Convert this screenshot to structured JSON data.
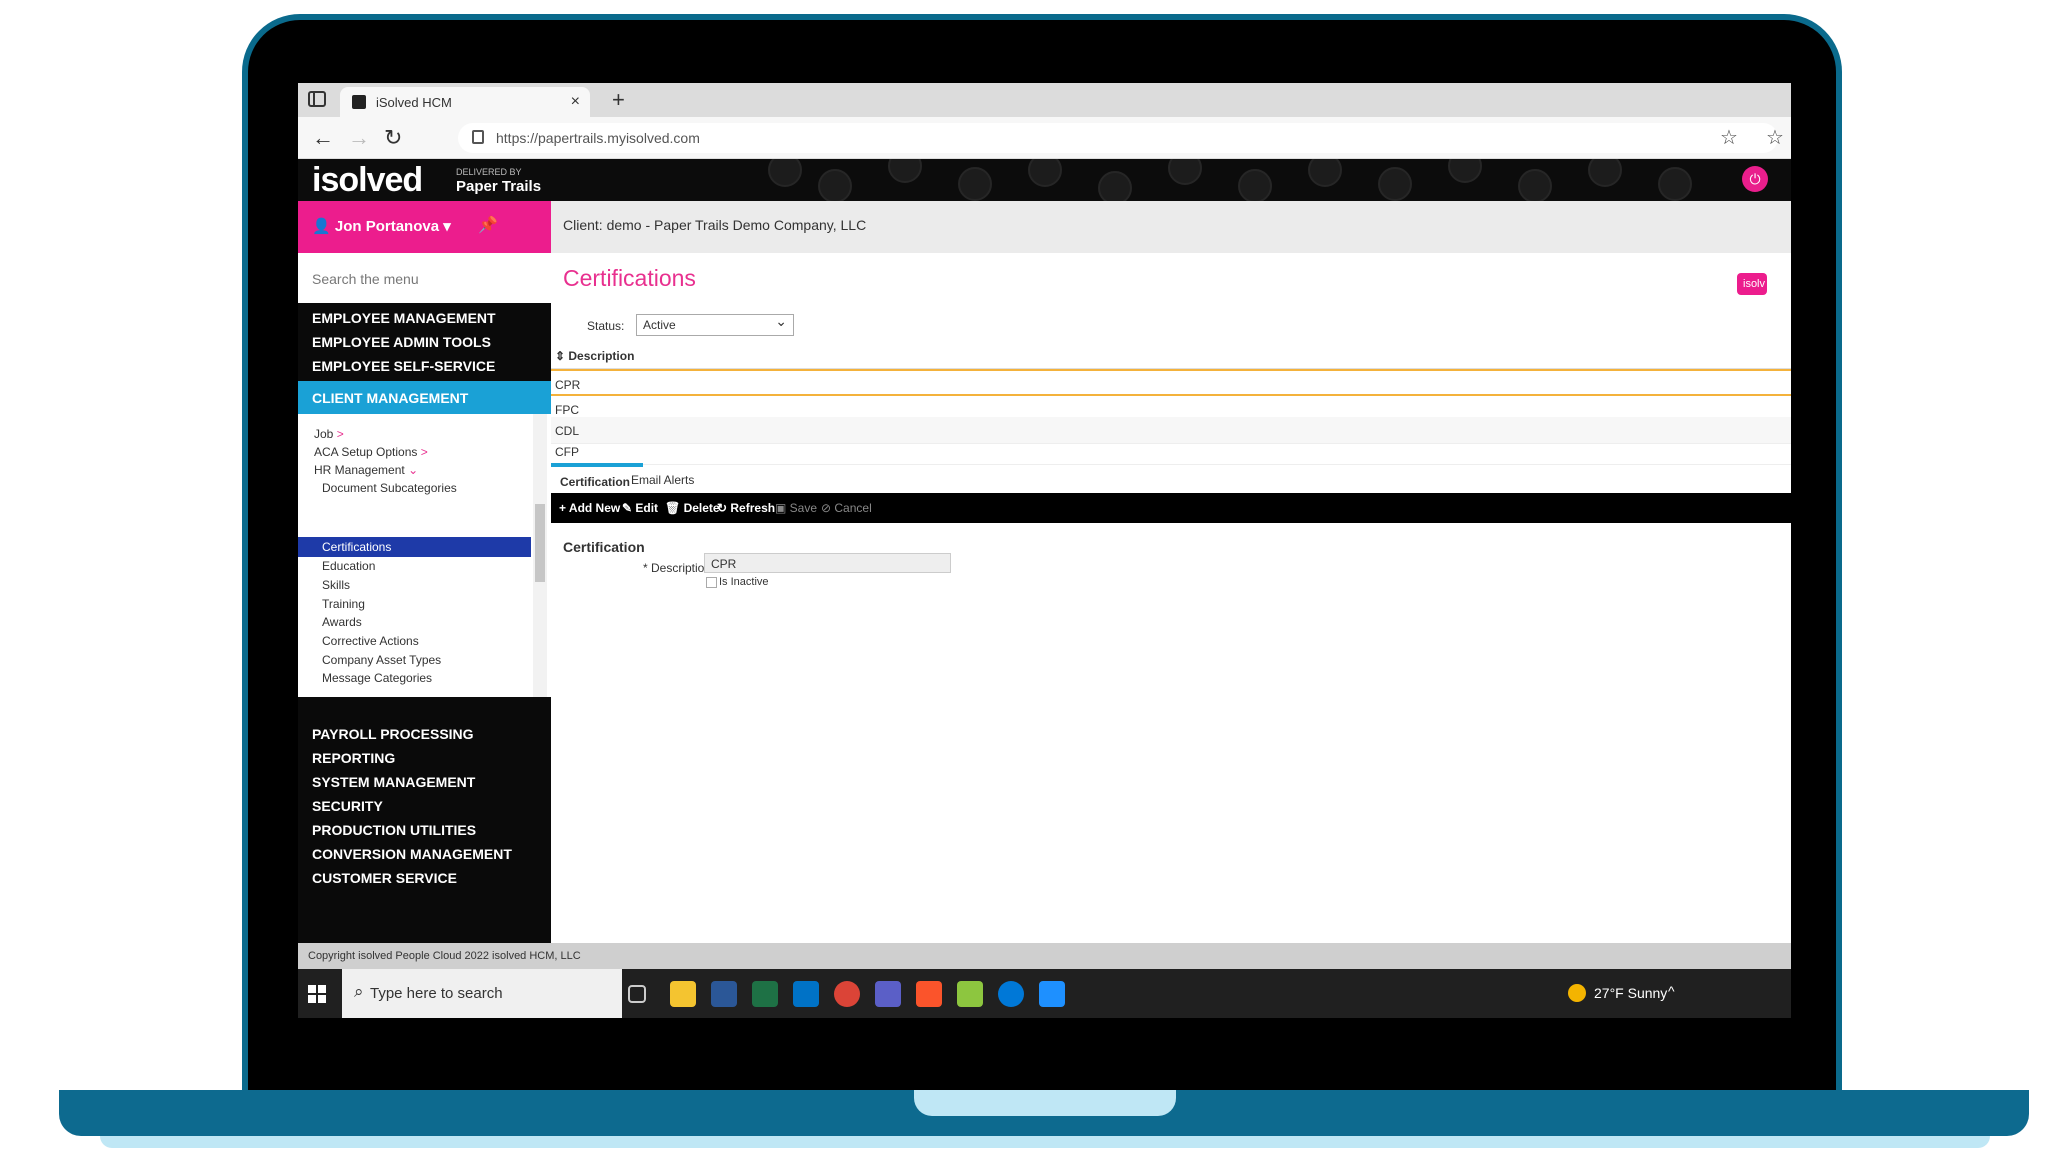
{
  "browser": {
    "tab_title": "iSolved HCM",
    "tab_close": "×",
    "new_tab": "+",
    "url": "https://papertrails.myisolved.com"
  },
  "header": {
    "logo": "isolved",
    "logo_sub_top": "DELIVERED BY",
    "logo_sub_bottom": "Paper Trails",
    "exit_label": "Ex"
  },
  "sidebar": {
    "user": "Jon Portanova ▾",
    "search_placeholder": "Search the menu",
    "top_items": [
      "EMPLOYEE MANAGEMENT",
      "EMPLOYEE ADMIN TOOLS",
      "EMPLOYEE SELF-SERVICE"
    ],
    "active_section": "CLIENT MANAGEMENT",
    "submenu": [
      {
        "label": "Job",
        "arrow": ">"
      },
      {
        "label": "ACA Setup Options",
        "arrow": ">"
      },
      {
        "label": "HR Management",
        "arrow": "⌄"
      },
      {
        "label": "Document Subcategories"
      },
      {
        "label": "Certifications"
      },
      {
        "label": "Education"
      },
      {
        "label": "Skills"
      },
      {
        "label": "Training"
      },
      {
        "label": "Awards"
      },
      {
        "label": "Corrective Actions"
      },
      {
        "label": "Company Asset Types"
      },
      {
        "label": "Message Categories"
      }
    ],
    "bottom_items": [
      "PAYROLL PROCESSING",
      "REPORTING",
      "SYSTEM MANAGEMENT",
      "SECURITY",
      "PRODUCTION UTILITIES",
      "CONVERSION MANAGEMENT",
      "CUSTOMER SERVICE"
    ]
  },
  "main": {
    "client": "Client: demo - Paper Trails Demo Company, LLC",
    "title": "Certifications",
    "badge": "isolv",
    "status_label": "Status:",
    "status_value": "Active",
    "grid_header": "⇕ Description",
    "rows": [
      "CPR",
      "FPC",
      "CDL",
      "CFP"
    ],
    "tabs": [
      "Certification",
      "Email Alerts"
    ],
    "toolbar": {
      "add": "+ Add New",
      "edit": "✎ Edit",
      "delete": "🗑 Delete",
      "refresh": "↻ Refresh",
      "save": "▣ Save",
      "cancel": "⊘ Cancel"
    },
    "form_title": "Certification",
    "desc_label": "* Description:",
    "desc_value": "CPR",
    "inactive_label": "Is Inactive"
  },
  "footer": "Copyright isolved People Cloud 2022 isolved HCM, LLC",
  "taskbar": {
    "search": "Type here to search",
    "weather": "27°F  Sunny",
    "tray": "^"
  }
}
